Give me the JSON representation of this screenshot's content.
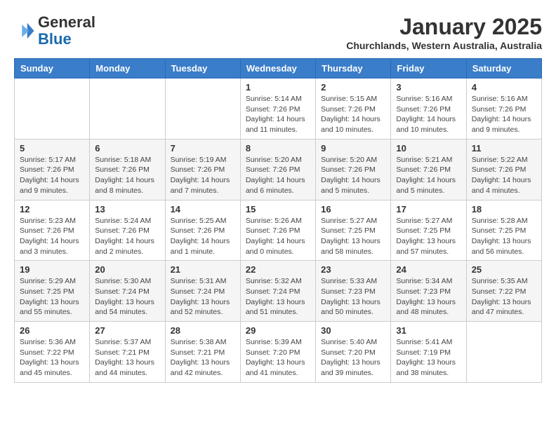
{
  "header": {
    "logo_line1": "General",
    "logo_line2": "Blue",
    "title": "January 2025",
    "subtitle": "Churchlands, Western Australia, Australia"
  },
  "weekdays": [
    "Sunday",
    "Monday",
    "Tuesday",
    "Wednesday",
    "Thursday",
    "Friday",
    "Saturday"
  ],
  "weeks": [
    [
      {
        "day": "",
        "info": ""
      },
      {
        "day": "",
        "info": ""
      },
      {
        "day": "",
        "info": ""
      },
      {
        "day": "1",
        "info": "Sunrise: 5:14 AM\nSunset: 7:26 PM\nDaylight: 14 hours\nand 11 minutes."
      },
      {
        "day": "2",
        "info": "Sunrise: 5:15 AM\nSunset: 7:26 PM\nDaylight: 14 hours\nand 10 minutes."
      },
      {
        "day": "3",
        "info": "Sunrise: 5:16 AM\nSunset: 7:26 PM\nDaylight: 14 hours\nand 10 minutes."
      },
      {
        "day": "4",
        "info": "Sunrise: 5:16 AM\nSunset: 7:26 PM\nDaylight: 14 hours\nand 9 minutes."
      }
    ],
    [
      {
        "day": "5",
        "info": "Sunrise: 5:17 AM\nSunset: 7:26 PM\nDaylight: 14 hours\nand 9 minutes."
      },
      {
        "day": "6",
        "info": "Sunrise: 5:18 AM\nSunset: 7:26 PM\nDaylight: 14 hours\nand 8 minutes."
      },
      {
        "day": "7",
        "info": "Sunrise: 5:19 AM\nSunset: 7:26 PM\nDaylight: 14 hours\nand 7 minutes."
      },
      {
        "day": "8",
        "info": "Sunrise: 5:20 AM\nSunset: 7:26 PM\nDaylight: 14 hours\nand 6 minutes."
      },
      {
        "day": "9",
        "info": "Sunrise: 5:20 AM\nSunset: 7:26 PM\nDaylight: 14 hours\nand 5 minutes."
      },
      {
        "day": "10",
        "info": "Sunrise: 5:21 AM\nSunset: 7:26 PM\nDaylight: 14 hours\nand 5 minutes."
      },
      {
        "day": "11",
        "info": "Sunrise: 5:22 AM\nSunset: 7:26 PM\nDaylight: 14 hours\nand 4 minutes."
      }
    ],
    [
      {
        "day": "12",
        "info": "Sunrise: 5:23 AM\nSunset: 7:26 PM\nDaylight: 14 hours\nand 3 minutes."
      },
      {
        "day": "13",
        "info": "Sunrise: 5:24 AM\nSunset: 7:26 PM\nDaylight: 14 hours\nand 2 minutes."
      },
      {
        "day": "14",
        "info": "Sunrise: 5:25 AM\nSunset: 7:26 PM\nDaylight: 14 hours\nand 1 minute."
      },
      {
        "day": "15",
        "info": "Sunrise: 5:26 AM\nSunset: 7:26 PM\nDaylight: 14 hours\nand 0 minutes."
      },
      {
        "day": "16",
        "info": "Sunrise: 5:27 AM\nSunset: 7:25 PM\nDaylight: 13 hours\nand 58 minutes."
      },
      {
        "day": "17",
        "info": "Sunrise: 5:27 AM\nSunset: 7:25 PM\nDaylight: 13 hours\nand 57 minutes."
      },
      {
        "day": "18",
        "info": "Sunrise: 5:28 AM\nSunset: 7:25 PM\nDaylight: 13 hours\nand 56 minutes."
      }
    ],
    [
      {
        "day": "19",
        "info": "Sunrise: 5:29 AM\nSunset: 7:25 PM\nDaylight: 13 hours\nand 55 minutes."
      },
      {
        "day": "20",
        "info": "Sunrise: 5:30 AM\nSunset: 7:24 PM\nDaylight: 13 hours\nand 54 minutes."
      },
      {
        "day": "21",
        "info": "Sunrise: 5:31 AM\nSunset: 7:24 PM\nDaylight: 13 hours\nand 52 minutes."
      },
      {
        "day": "22",
        "info": "Sunrise: 5:32 AM\nSunset: 7:24 PM\nDaylight: 13 hours\nand 51 minutes."
      },
      {
        "day": "23",
        "info": "Sunrise: 5:33 AM\nSunset: 7:23 PM\nDaylight: 13 hours\nand 50 minutes."
      },
      {
        "day": "24",
        "info": "Sunrise: 5:34 AM\nSunset: 7:23 PM\nDaylight: 13 hours\nand 48 minutes."
      },
      {
        "day": "25",
        "info": "Sunrise: 5:35 AM\nSunset: 7:22 PM\nDaylight: 13 hours\nand 47 minutes."
      }
    ],
    [
      {
        "day": "26",
        "info": "Sunrise: 5:36 AM\nSunset: 7:22 PM\nDaylight: 13 hours\nand 45 minutes."
      },
      {
        "day": "27",
        "info": "Sunrise: 5:37 AM\nSunset: 7:21 PM\nDaylight: 13 hours\nand 44 minutes."
      },
      {
        "day": "28",
        "info": "Sunrise: 5:38 AM\nSunset: 7:21 PM\nDaylight: 13 hours\nand 42 minutes."
      },
      {
        "day": "29",
        "info": "Sunrise: 5:39 AM\nSunset: 7:20 PM\nDaylight: 13 hours\nand 41 minutes."
      },
      {
        "day": "30",
        "info": "Sunrise: 5:40 AM\nSunset: 7:20 PM\nDaylight: 13 hours\nand 39 minutes."
      },
      {
        "day": "31",
        "info": "Sunrise: 5:41 AM\nSunset: 7:19 PM\nDaylight: 13 hours\nand 38 minutes."
      },
      {
        "day": "",
        "info": ""
      }
    ]
  ]
}
